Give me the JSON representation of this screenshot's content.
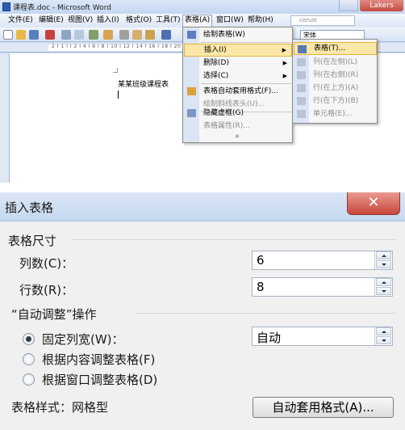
{
  "word": {
    "title": "课程表.doc - Microsoft Word",
    "close_label": "Lakers",
    "search_placeholder": "cerust",
    "menubar": [
      "文件(E)",
      "编辑(E)",
      "视图(V)",
      "插入(I)",
      "格式(O)",
      "工具(T)",
      "表格(A)",
      "窗口(W)",
      "帮助(H)"
    ],
    "font_name": "宋体",
    "ruler_text": "2 I 1 I I 2 I 4 I 6 I 8 I 10 I 12 I 14 I 16 I 18 I 20 I 22 I 24",
    "document_text": "某某班级课程表",
    "table_menu": [
      {
        "label": "绘制表格(W)",
        "icon": "pencil-icon"
      },
      {
        "label": "插入(I)",
        "icon": ""
      },
      {
        "label": "删除(D)",
        "icon": ""
      },
      {
        "label": "选择(C)",
        "icon": ""
      },
      {
        "label": "表格自动套用格式(F)...",
        "icon": "autoformat-icon"
      },
      {
        "label": "绘制斜线表头(U)...",
        "icon": ""
      },
      {
        "label": "隐藏虚框(G)",
        "icon": "gridlines-icon"
      },
      {
        "label": "表格属性(R)...",
        "icon": ""
      }
    ],
    "insert_submenu": [
      "表格(T)...",
      "列(在左侧)(L)",
      "列(在右侧)(R)",
      "行(在上方)(A)",
      "行(在下方)(B)",
      "单元格(E)..."
    ]
  },
  "dialog": {
    "title": "插入表格",
    "close_glyph": "✕",
    "size_section": "表格尺寸",
    "columns_label": "列数(C)：",
    "columns_value": "6",
    "rows_label": "行数(R)：",
    "rows_value": "8",
    "autofit_section": "“自动调整”操作",
    "fixed_width_label": "固定列宽(W)：",
    "fixed_width_value": "自动",
    "fit_contents_label": "根据内容调整表格(F)",
    "fit_window_label": "根据窗口调整表格(D)",
    "style_label": "表格样式：网格型",
    "autoformat_button": "自动套用格式(A)..."
  }
}
